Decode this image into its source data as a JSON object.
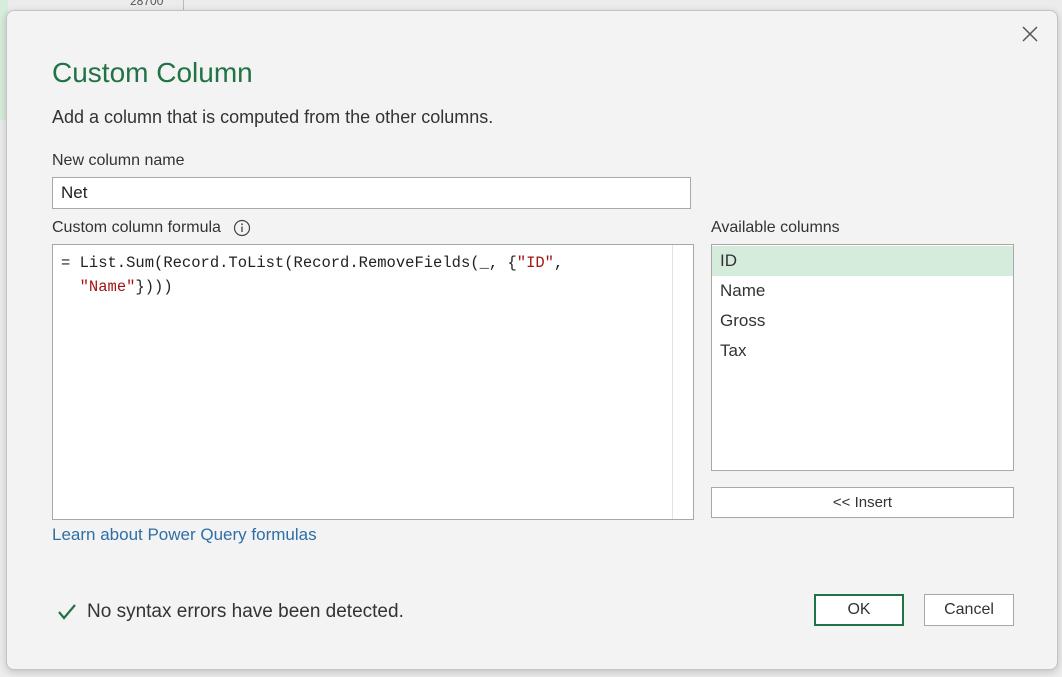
{
  "background": {
    "partial_value": "28700"
  },
  "dialog": {
    "title": "Custom Column",
    "subtitle": "Add a column that is computed from the other columns.",
    "close_icon": "close-icon",
    "new_column_name_label": "New column name",
    "new_column_name_value": "Net",
    "formula_label": "Custom column formula",
    "formula_info_icon": "info-icon",
    "formula": {
      "line1_prefix": "= List.Sum(Record.ToList(Record.RemoveFields(_, {",
      "line1_string": "\"ID\"",
      "line1_suffix": ",",
      "line2_indent": "  ",
      "line2_string": "\"Name\"",
      "line2_suffix": "})))"
    },
    "available_columns_label": "Available columns",
    "available_columns": [
      "ID",
      "Name",
      "Gross",
      "Tax"
    ],
    "selected_column": "ID",
    "insert_label": "<< Insert",
    "learn_link": "Learn about Power Query formulas",
    "status_icon": "checkmark-icon",
    "status_text": "No syntax errors have been detected.",
    "ok_label": "OK",
    "cancel_label": "Cancel"
  },
  "colors": {
    "accent": "#217346",
    "link": "#2e6fa7",
    "selection": "#d5ebdc",
    "string_literal": "#a31515"
  }
}
